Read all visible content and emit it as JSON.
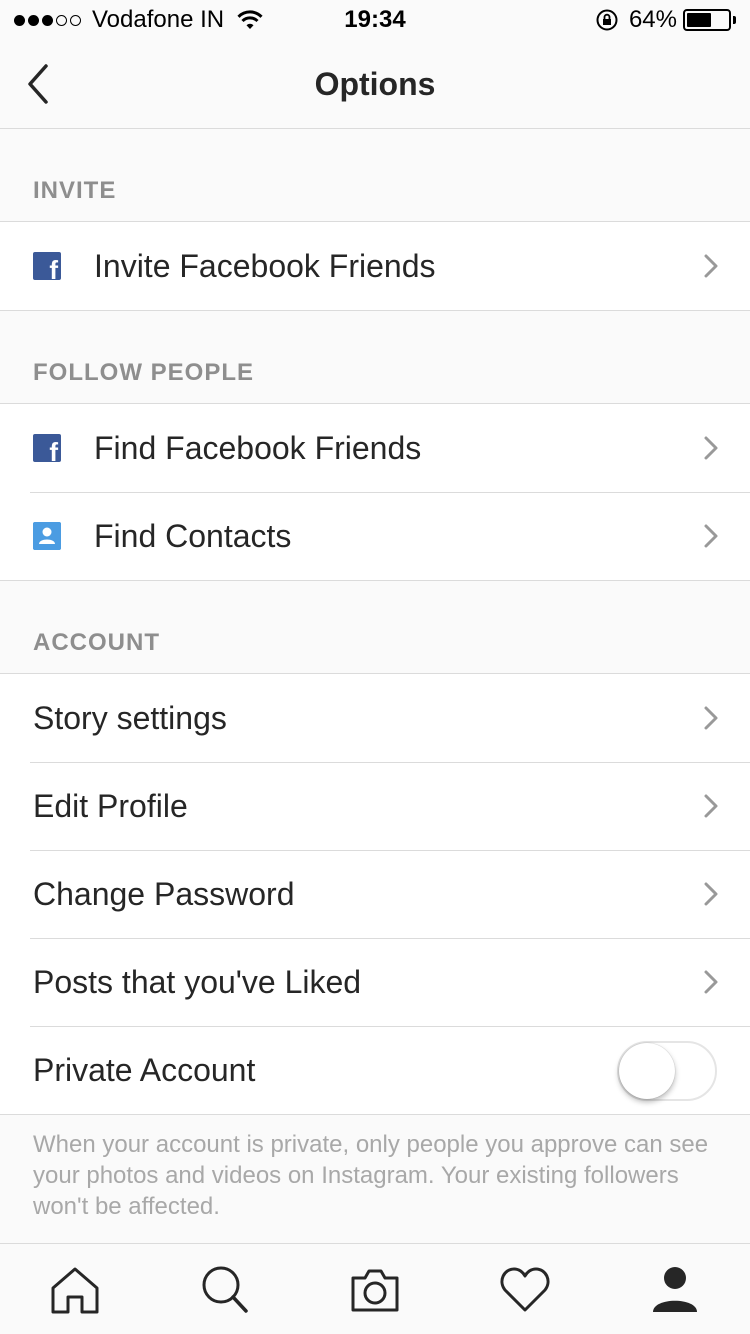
{
  "status_bar": {
    "carrier": "Vodafone IN",
    "time": "19:34",
    "battery_percent": "64%",
    "battery_level": 0.64,
    "signal_bars_filled": 3,
    "signal_bars_total": 5
  },
  "nav": {
    "title": "Options",
    "back_icon": "chevron-left-icon"
  },
  "sections": {
    "invite": {
      "header": "INVITE",
      "items": [
        {
          "label": "Invite Facebook Friends",
          "icon": "facebook-icon"
        }
      ]
    },
    "follow_people": {
      "header": "FOLLOW PEOPLE",
      "items": [
        {
          "label": "Find Facebook Friends",
          "icon": "facebook-icon"
        },
        {
          "label": "Find Contacts",
          "icon": "contact-icon"
        }
      ]
    },
    "account": {
      "header": "ACCOUNT",
      "items": [
        {
          "label": "Story settings"
        },
        {
          "label": "Edit Profile"
        },
        {
          "label": "Change Password"
        },
        {
          "label": "Posts that you've Liked"
        }
      ],
      "private_account": {
        "label": "Private Account",
        "enabled": false,
        "note": "When your account is private, only people you approve can see your photos and videos on Instagram. Your existing followers won't be affected."
      }
    }
  },
  "tab_bar": {
    "tabs": [
      "home-icon",
      "search-icon",
      "camera-icon",
      "heart-icon",
      "profile-icon"
    ],
    "active": "profile-icon"
  },
  "colors": {
    "facebook": "#3b5998",
    "contacts": "#4b9ce2",
    "section_header": "#8e8e8e",
    "divider": "#dbdbdb",
    "note_text": "#a8a8a8"
  }
}
